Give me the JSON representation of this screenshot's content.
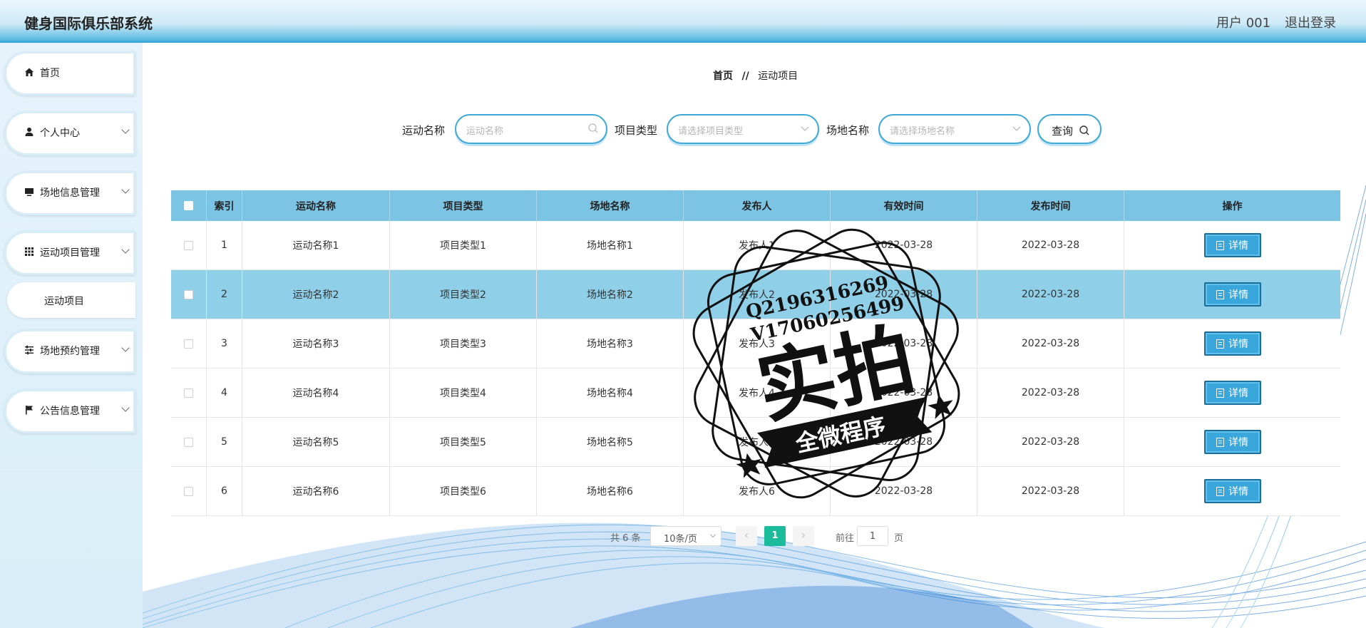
{
  "header": {
    "title": "健身国际俱乐部系统",
    "user": "用户 001",
    "logout": "退出登录"
  },
  "sidebar": {
    "items": [
      {
        "label": "首页",
        "icon": "home-icon",
        "arrow": false
      },
      {
        "label": "个人中心",
        "icon": "user-icon",
        "arrow": true
      },
      {
        "label": "场地信息管理",
        "icon": "monitor-icon",
        "arrow": true
      },
      {
        "label": "运动项目管理",
        "icon": "grid-icon",
        "arrow": true
      },
      {
        "label": "场地预约管理",
        "icon": "sliders-icon",
        "arrow": true
      },
      {
        "label": "公告信息管理",
        "icon": "flag-icon",
        "arrow": true
      }
    ],
    "submenu": {
      "label": "运动项目"
    }
  },
  "breadcrumb": {
    "home": "首页",
    "separator": "//",
    "current": "运动项目"
  },
  "search": {
    "name_label": "运动名称",
    "name_placeholder": "运动名称",
    "type_label": "项目类型",
    "type_placeholder": "请选择项目类型",
    "venue_label": "场地名称",
    "venue_placeholder": "请选择场地名称",
    "button_label": "查询"
  },
  "table": {
    "headers": [
      "索引",
      "运动名称",
      "项目类型",
      "场地名称",
      "发布人",
      "有效时间",
      "发布时间",
      "操作"
    ],
    "rows": [
      {
        "index": "1",
        "name": "运动名称1",
        "type": "项目类型1",
        "venue": "场地名称1",
        "publisher": "发布人1",
        "valid": "2022-03-28",
        "published": "2022-03-28",
        "action": "详情"
      },
      {
        "index": "2",
        "name": "运动名称2",
        "type": "项目类型2",
        "venue": "场地名称2",
        "publisher": "发布人2",
        "valid": "2022-03-28",
        "published": "2022-03-28",
        "action": "详情"
      },
      {
        "index": "3",
        "name": "运动名称3",
        "type": "项目类型3",
        "venue": "场地名称3",
        "publisher": "发布人3",
        "valid": "2022-03-28",
        "published": "2022-03-28",
        "action": "详情"
      },
      {
        "index": "4",
        "name": "运动名称4",
        "type": "项目类型4",
        "venue": "场地名称4",
        "publisher": "发布人4",
        "valid": "2022-03-28",
        "published": "2022-03-28",
        "action": "详情"
      },
      {
        "index": "5",
        "name": "运动名称5",
        "type": "项目类型5",
        "venue": "场地名称5",
        "publisher": "发布人5",
        "valid": "2022-03-28",
        "published": "2022-03-28",
        "action": "详情"
      },
      {
        "index": "6",
        "name": "运动名称6",
        "type": "项目类型6",
        "venue": "场地名称6",
        "publisher": "发布人6",
        "valid": "2022-03-28",
        "published": "2022-03-28",
        "action": "详情"
      }
    ]
  },
  "pagination": {
    "total": "共 6 条",
    "page_size": "10条/页",
    "current": "1",
    "goto_label": "前往",
    "goto_value": "1",
    "page_suffix": "页"
  },
  "watermark": {
    "line1": "Q2196316269",
    "line2": "V17060256499",
    "main": "实拍",
    "banner": "全微程序"
  },
  "colors": {
    "header_accent": "#2aa0d6",
    "table_header": "#7cc4e4",
    "row_highlight": "#8fcfe8",
    "detail_button": "#3aa7dc",
    "page_active": "#1bbc9b"
  }
}
